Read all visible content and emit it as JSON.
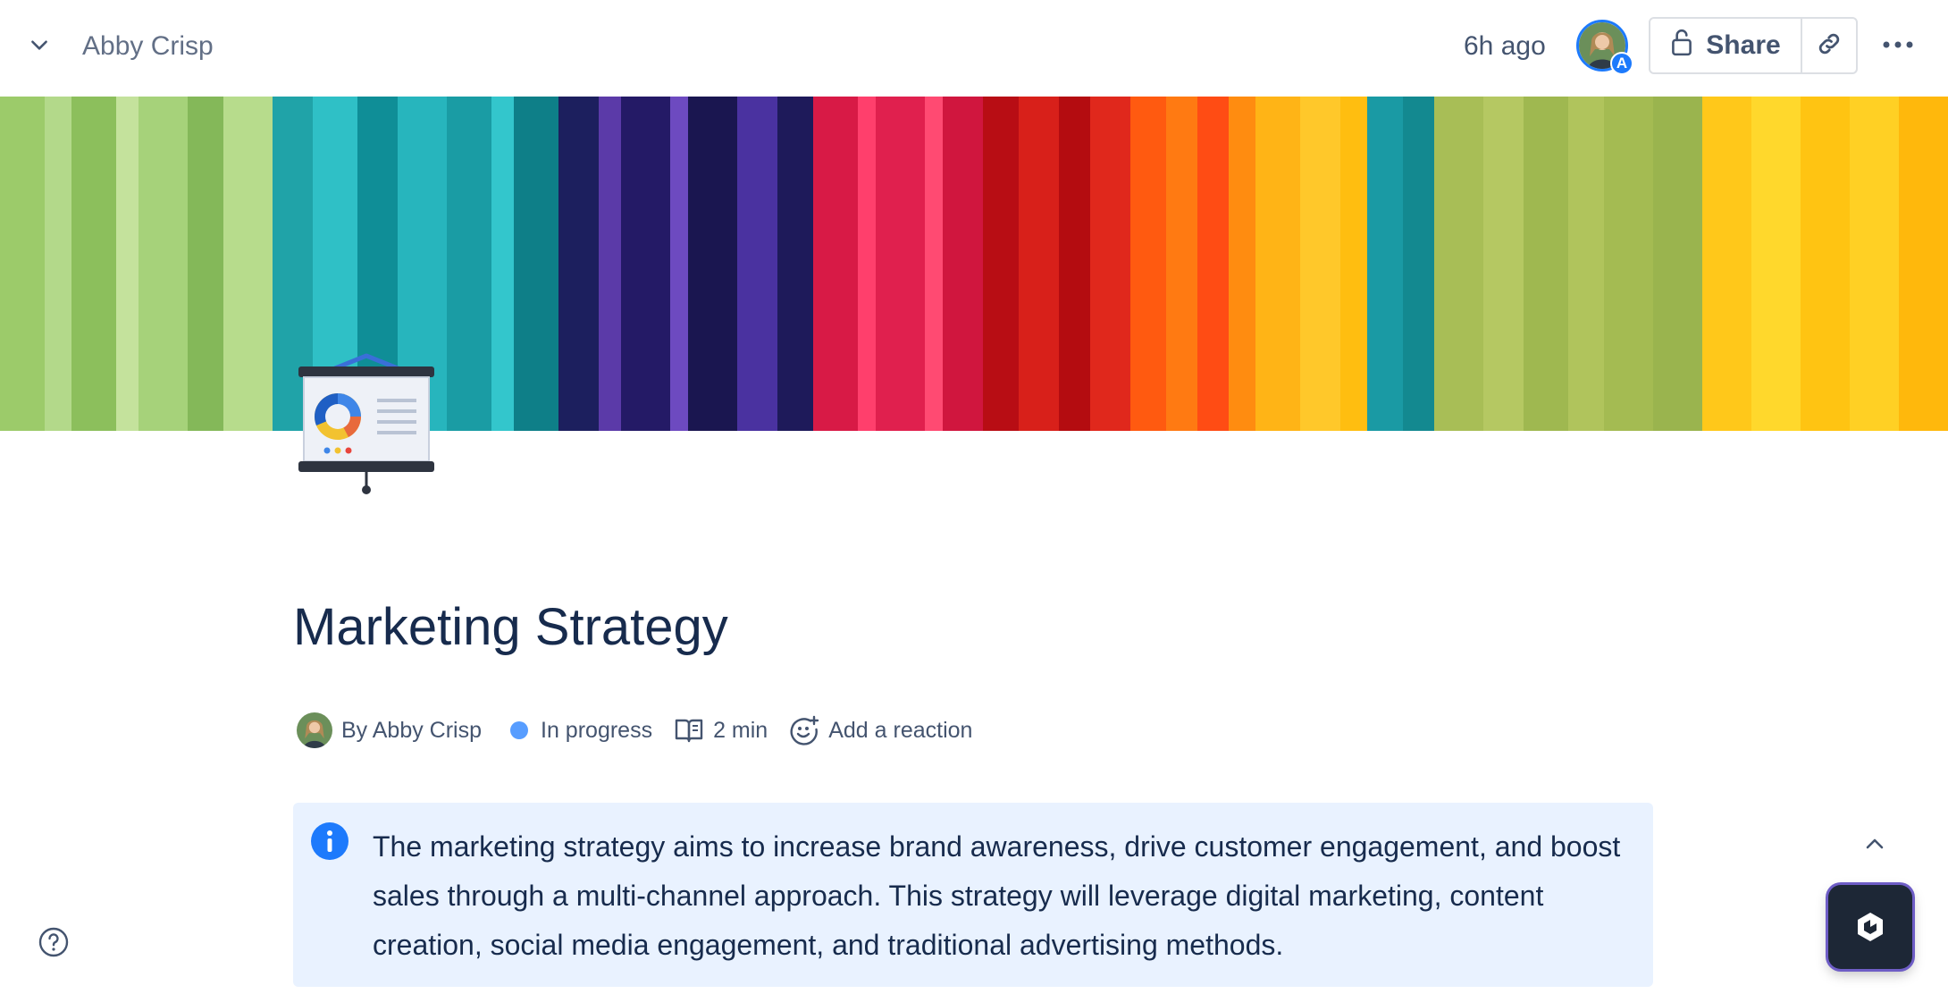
{
  "topbar": {
    "owner": "Abby Crisp",
    "updated": "6h ago",
    "avatar_badge": "A",
    "share_label": "Share",
    "icons": [
      "chevron-down-icon",
      "lock-open-icon",
      "link-icon",
      "more-icon"
    ]
  },
  "page": {
    "title": "Marketing Strategy",
    "emoji": "presentation-board-icon",
    "meta": {
      "author": "By Abby Crisp",
      "status": "In progress",
      "status_color": "#579dff",
      "read_time": "2 min",
      "reaction": "Add a reaction"
    },
    "info_panel": {
      "text": "The marketing strategy aims to increase brand awareness, drive customer engagement, and boost sales through a multi-channel approach. This strategy will leverage digital marketing, content creation, social media engagement, and traditional advertising methods."
    }
  },
  "colors": {
    "accent": "#1d7afc",
    "info_background": "#e9f2ff",
    "text_primary": "#172b4d",
    "text_subtle": "#44546f"
  }
}
